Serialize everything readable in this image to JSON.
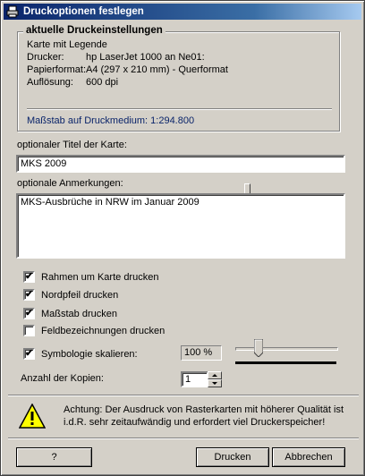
{
  "window": {
    "title": "Druckoptionen festlegen"
  },
  "settings": {
    "group_title": "aktuelle Druckeinstellungen",
    "type": "Karte mit Legende",
    "printer_label": "Drucker:",
    "printer_value": "hp LaserJet 1000 an Ne01:",
    "paper_label": "Papierformat:",
    "paper_value": "A4 (297 x 210 mm) - Querformat",
    "resolution_label": "Auflösung:",
    "resolution_value": "600 dpi",
    "scale_text": "Maßstab auf Druckmedium: 1:294.800"
  },
  "form": {
    "title_label": "optionaler Titel der Karte:",
    "title_value": "MKS 2009",
    "notes_label": "optionale Anmerkungen:",
    "notes_value": "MKS-Ausbrüche in NRW im Januar 2009"
  },
  "options": [
    {
      "label": "Rahmen um Karte drucken",
      "checked": true
    },
    {
      "label": "Nordpfeil drucken",
      "checked": true
    },
    {
      "label": "Maßstab drucken",
      "checked": true
    },
    {
      "label": "Feldbezeichnungen drucken",
      "checked": false
    },
    {
      "label": "Symbologie skalieren:",
      "checked": true
    }
  ],
  "symbology": {
    "value": "100 %",
    "slider_fraction": 0.2
  },
  "copies": {
    "label": "Anzahl der Kopien:",
    "value": "1"
  },
  "warning": {
    "line1": "Achtung: Der Ausdruck von Rasterkarten mit höherer Qualität ist",
    "line2": "i.d.R. sehr zeitaufwändig und erfordert viel Druckerspeicher!"
  },
  "buttons": {
    "help": "?",
    "print": "Drucken",
    "cancel": "Abbrechen"
  },
  "colors": {
    "title_start": "#0a246a",
    "title_end": "#a6caf0",
    "face": "#d4d0c8",
    "scale_text": "#0a246a",
    "warning_yellow": "#ffff00"
  }
}
